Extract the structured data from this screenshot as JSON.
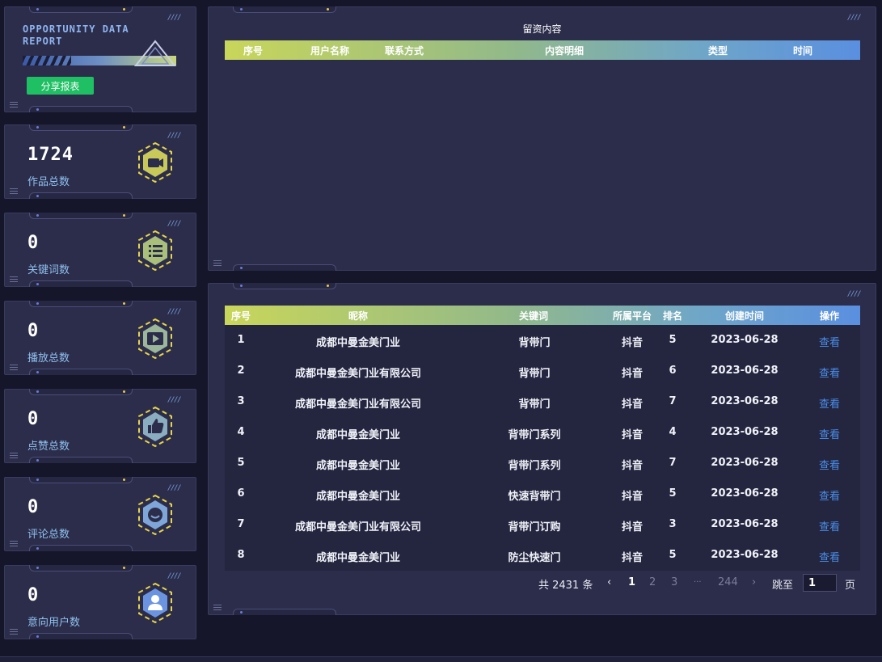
{
  "report": {
    "title_line1": "OPPORTUNITY DATA",
    "title_line2": "REPORT",
    "share_label": "分享报表"
  },
  "stats": [
    {
      "value": "1724",
      "label": "作品总数",
      "icon": "video-camera-icon"
    },
    {
      "value": "0",
      "label": "关键词数",
      "icon": "list-icon"
    },
    {
      "value": "0",
      "label": "播放总数",
      "icon": "play-icon"
    },
    {
      "value": "0",
      "label": "点赞总数",
      "icon": "thumbs-up-icon"
    },
    {
      "value": "0",
      "label": "评论总数",
      "icon": "comment-icon"
    },
    {
      "value": "0",
      "label": "意向用户数",
      "icon": "user-icon"
    }
  ],
  "leads": {
    "title": "留资内容",
    "headers": [
      "序号",
      "用户名称",
      "联系方式",
      "内容明细",
      "类型",
      "时间"
    ]
  },
  "ranking": {
    "headers": [
      "序号",
      "昵称",
      "关键词",
      "所属平台",
      "排名",
      "创建时间",
      "操作"
    ],
    "rows": [
      {
        "idx": "1",
        "name": "成都中曼金美门业",
        "keyword": "背带门",
        "platform": "抖音",
        "rank": "5",
        "date": "2023-06-28",
        "action": "查看"
      },
      {
        "idx": "2",
        "name": "成都中曼金美门业有限公司",
        "keyword": "背带门",
        "platform": "抖音",
        "rank": "6",
        "date": "2023-06-28",
        "action": "查看"
      },
      {
        "idx": "3",
        "name": "成都中曼金美门业有限公司",
        "keyword": "背带门",
        "platform": "抖音",
        "rank": "7",
        "date": "2023-06-28",
        "action": "查看"
      },
      {
        "idx": "4",
        "name": "成都中曼金美门业",
        "keyword": "背带门系列",
        "platform": "抖音",
        "rank": "4",
        "date": "2023-06-28",
        "action": "查看"
      },
      {
        "idx": "5",
        "name": "成都中曼金美门业",
        "keyword": "背带门系列",
        "platform": "抖音",
        "rank": "7",
        "date": "2023-06-28",
        "action": "查看"
      },
      {
        "idx": "6",
        "name": "成都中曼金美门业",
        "keyword": "快速背带门",
        "platform": "抖音",
        "rank": "5",
        "date": "2023-06-28",
        "action": "查看"
      },
      {
        "idx": "7",
        "name": "成都中曼金美门业有限公司",
        "keyword": "背带门订购",
        "platform": "抖音",
        "rank": "3",
        "date": "2023-06-28",
        "action": "查看"
      },
      {
        "idx": "8",
        "name": "成都中曼金美门业",
        "keyword": "防尘快速门",
        "platform": "抖音",
        "rank": "5",
        "date": "2023-06-28",
        "action": "查看"
      }
    ]
  },
  "pagination": {
    "total": "共 2431 条",
    "prev": "‹",
    "pages": [
      "1",
      "2",
      "3"
    ],
    "ellipsis": "···",
    "last": "244",
    "next": "›",
    "jump_label": "跳至",
    "jump_value": "1",
    "page_unit": "页"
  },
  "decor": {
    "ticks": "////"
  },
  "colors": {
    "accent_green": "#1fbf63",
    "link_blue": "#4a8ee8",
    "header_start": "#c9d65a",
    "header_end": "#5a8fe0"
  }
}
